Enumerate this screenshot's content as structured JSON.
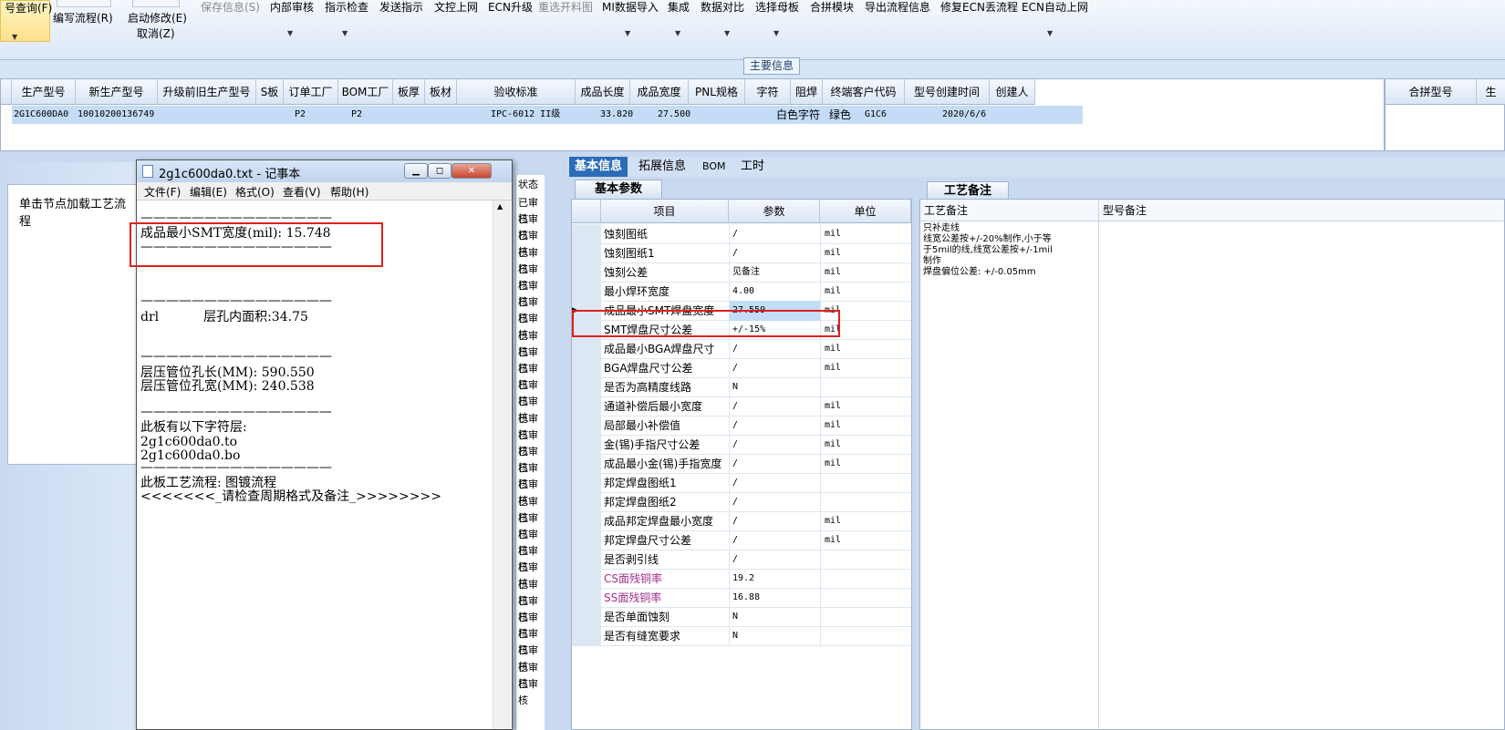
{
  "ribbon": {
    "query": "号查询(F)",
    "write_flow": "编写流程(R)",
    "start_modify": "启动修改(E)",
    "cancel": "取消(Z)",
    "save_info": "保存信息(S)",
    "internal_review": "内部审核",
    "instruction_check": "指示检查",
    "send_instruction": "发送指示",
    "doc_upload": "文控上网",
    "ecn_upgrade": "ECN升级",
    "reselect_cut": "重选开料图",
    "mi_import": "MI数据导入",
    "integrate": "集成",
    "data_compare": "数据对比",
    "select_mother": "选择母板",
    "panel_module": "合拼模块",
    "export_flow": "导出流程信息",
    "fix_ecn": "修复ECN丢流程",
    "ecn_auto": "ECN自动上网"
  },
  "main_info_label": "主要信息",
  "top_grid": {
    "headers": [
      "生产型号",
      "新生产型号",
      "升级前旧生产型号",
      "S板",
      "订单工厂",
      "BOM工厂",
      "板厚",
      "板材",
      "验收标准",
      "成品长度",
      "成品宽度",
      "PNL规格",
      "字符",
      "阻焊",
      "终端客户代码",
      "型号创建时间",
      "创建人"
    ],
    "row": [
      "2G1C600DA0",
      "10010200136749",
      "",
      "",
      "P2",
      "P2",
      "",
      "",
      "IPC-6012 II级",
      "33.820",
      "27.500",
      "",
      "白色字符",
      "绿色",
      "G1C6",
      "2020/6/6",
      ""
    ],
    "right_headers": [
      "合拼型号",
      "生"
    ]
  },
  "left_panel": {
    "load_flow": "单击节点加载工艺流程",
    "status_header": "状态",
    "status_value": "已审核"
  },
  "notepad": {
    "title": "2g1c600da0.txt - 记事本",
    "menu": [
      "文件(F)",
      "编辑(E)",
      "格式(O)",
      "查看(V)",
      "帮助(H)"
    ],
    "dashes": "———————————————",
    "line_smt": "成品最小SMT宽度(mil): 15.748",
    "line_drl": "drl           层孔内面积:34.75",
    "line_len": "层压管位孔长(MM): 590.550",
    "line_wid": "层压管位孔宽(MM): 240.538",
    "line_char": "此板有以下字符层:",
    "line_to": "2g1c600da0.to",
    "line_bo": "2g1c600da0.bo",
    "line_flow": "此板工艺流程: 图镀流程",
    "line_check": "<<<<<<<_请检查周期格式及备注_>>>>>>>>"
  },
  "right_tabs": [
    "基本信息",
    "拓展信息",
    "BOM",
    "工时"
  ],
  "basic_params_tab": "基本参数",
  "params_grid": {
    "headers": [
      "项目",
      "参数",
      "单位"
    ],
    "rows": [
      {
        "item": "蚀刻图纸",
        "value": "/",
        "unit": "mil"
      },
      {
        "item": "蚀刻图纸1",
        "value": "/",
        "unit": "mil"
      },
      {
        "item": "蚀刻公差",
        "value": "见备注",
        "unit": "mil"
      },
      {
        "item": "最小焊环宽度",
        "value": "4.00",
        "unit": "mil"
      },
      {
        "item": "成品最小SMT焊盘宽度",
        "value": "27.559",
        "unit": "mil"
      },
      {
        "item": "SMT焊盘尺寸公差",
        "value": "+/-15%",
        "unit": "mil"
      },
      {
        "item": "成品最小BGA焊盘尺寸",
        "value": "/",
        "unit": "mil"
      },
      {
        "item": "BGA焊盘尺寸公差",
        "value": "/",
        "unit": "mil"
      },
      {
        "item": "是否为高精度线路",
        "value": "N",
        "unit": ""
      },
      {
        "item": "通道补偿后最小宽度",
        "value": "/",
        "unit": "mil"
      },
      {
        "item": "局部最小补偿值",
        "value": "/",
        "unit": "mil"
      },
      {
        "item": "金(锡)手指尺寸公差",
        "value": "/",
        "unit": "mil"
      },
      {
        "item": "成品最小金(锡)手指宽度",
        "value": "/",
        "unit": "mil"
      },
      {
        "item": "邦定焊盘图纸1",
        "value": "/",
        "unit": ""
      },
      {
        "item": "邦定焊盘图纸2",
        "value": "/",
        "unit": ""
      },
      {
        "item": "成品邦定焊盘最小宽度",
        "value": "/",
        "unit": "mil"
      },
      {
        "item": "邦定焊盘尺寸公差",
        "value": "/",
        "unit": "mil"
      },
      {
        "item": "是否剥引线",
        "value": "/",
        "unit": ""
      },
      {
        "item": "CS面残铜率",
        "value": "19.2",
        "unit": ""
      },
      {
        "item": "SS面残铜率",
        "value": "16.88",
        "unit": ""
      },
      {
        "item": "是否单面蚀刻",
        "value": "N",
        "unit": ""
      },
      {
        "item": "是否有缝宽要求",
        "value": "N",
        "unit": ""
      }
    ]
  },
  "process_tab": "工艺备注",
  "process_headers": [
    "工艺备注",
    "型号备注"
  ],
  "process_notes": [
    "只补走线",
    "线宽公差按+/-20%制作,小于等",
    "于5mil的线,线宽公差按+/-1mil",
    "制作",
    "焊盘偏位公差: +/-0.05mm"
  ],
  "colors": {
    "highlight": "#e0201c",
    "selection": "#c4dcf6",
    "purple_text": "#a0308f"
  }
}
